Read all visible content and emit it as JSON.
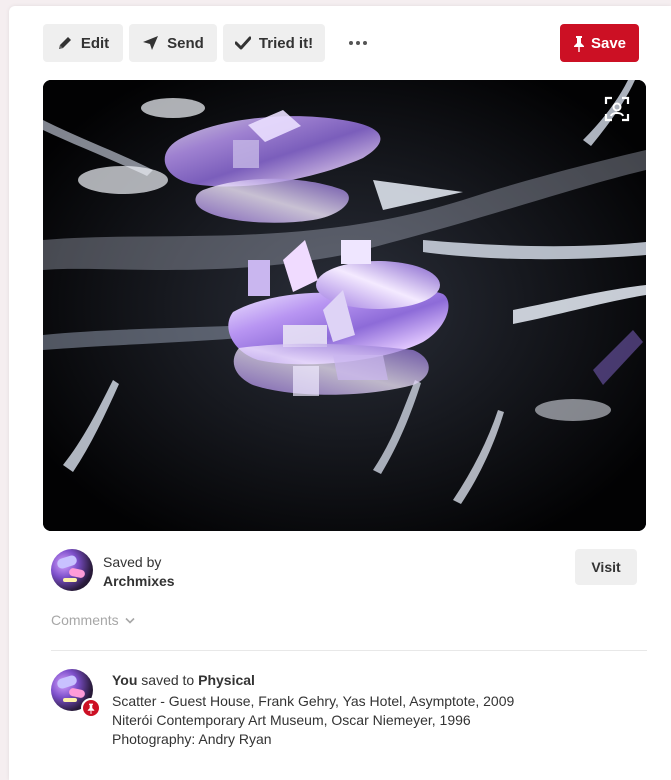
{
  "toolbar": {
    "edit_label": "Edit",
    "send_label": "Send",
    "tried_label": "Tried it!",
    "save_label": "Save"
  },
  "icons": {
    "edit": "pencil-icon",
    "send": "paper-plane-icon",
    "tried": "checkmark-icon",
    "more": "more-horizontal-icon",
    "save": "pin-icon",
    "lens": "visual-search-icon",
    "comments": "chevron-down-icon"
  },
  "colors": {
    "accent": "#cc1024",
    "button_bg": "#efefef"
  },
  "saved_by": {
    "label": "Saved by",
    "user": "Archmixes"
  },
  "visit_label": "Visit",
  "comments_label": "Comments",
  "activity": {
    "actor": "You",
    "verb": "saved to",
    "board": "Physical",
    "description": "Scatter - Guest House, Frank Gehry, Yas Hotel, Asymptote, 2009 Niterói Contemporary Art Museum, Oscar Niemeyer, 1996 Photography: Andry Ryan"
  }
}
